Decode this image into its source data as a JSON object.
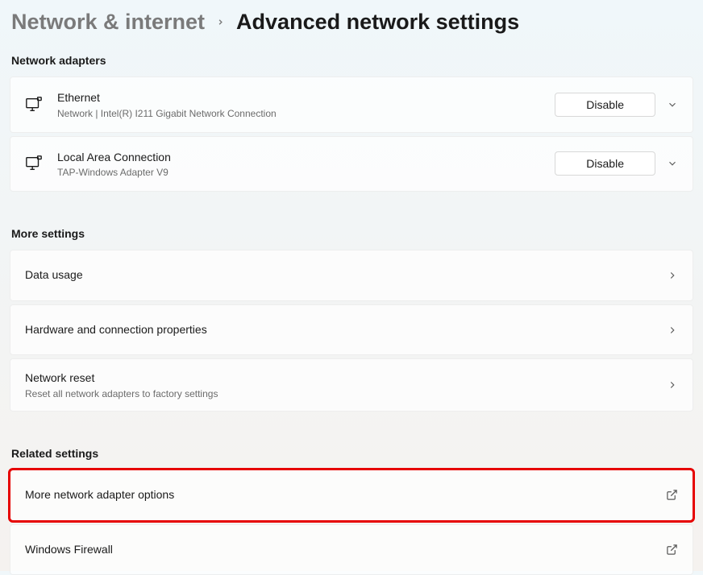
{
  "breadcrumb": {
    "parent": "Network & internet",
    "current": "Advanced network settings"
  },
  "sections": {
    "adapters": {
      "title": "Network adapters",
      "items": [
        {
          "name": "Ethernet",
          "subtitle": "Network | Intel(R) I211 Gigabit Network Connection",
          "button_label": "Disable"
        },
        {
          "name": "Local Area Connection",
          "subtitle": "TAP-Windows Adapter V9",
          "button_label": "Disable"
        }
      ]
    },
    "more": {
      "title": "More settings",
      "items": [
        {
          "name": "Data usage"
        },
        {
          "name": "Hardware and connection properties"
        },
        {
          "name": "Network reset",
          "subtitle": "Reset all network adapters to factory settings"
        }
      ]
    },
    "related": {
      "title": "Related settings",
      "items": [
        {
          "name": "More network adapter options"
        },
        {
          "name": "Windows Firewall"
        }
      ]
    }
  }
}
